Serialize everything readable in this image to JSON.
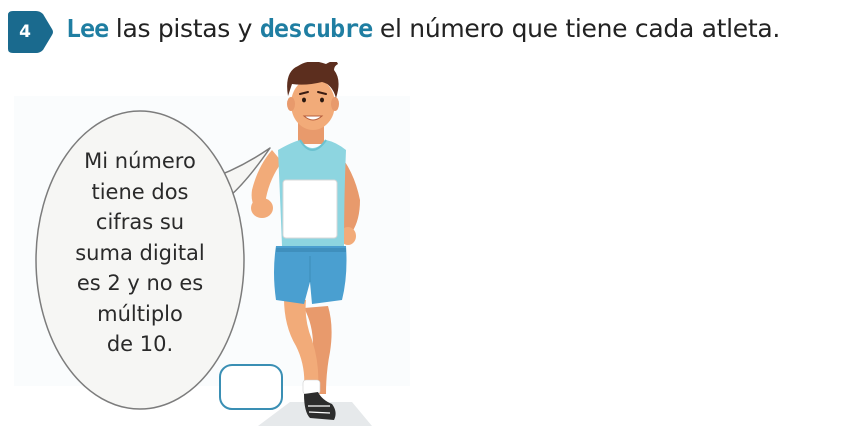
{
  "exercise": {
    "number": "4",
    "instruction": {
      "word1": "Lee",
      "part2": " las pistas y ",
      "word2": "descubre",
      "part3": " el número que tiene cada atleta."
    }
  },
  "clue": {
    "lines": [
      "Mi número",
      "tiene dos",
      "cifras su",
      "suma digital",
      "es 2 y no es",
      "múltiplo",
      "de 10."
    ]
  },
  "answer": {
    "value": ""
  },
  "colors": {
    "accent": "#1f7ea2",
    "badge": "#1a6a8e",
    "tank_top": "#8dd5e0",
    "shorts": "#4a9fd0"
  }
}
